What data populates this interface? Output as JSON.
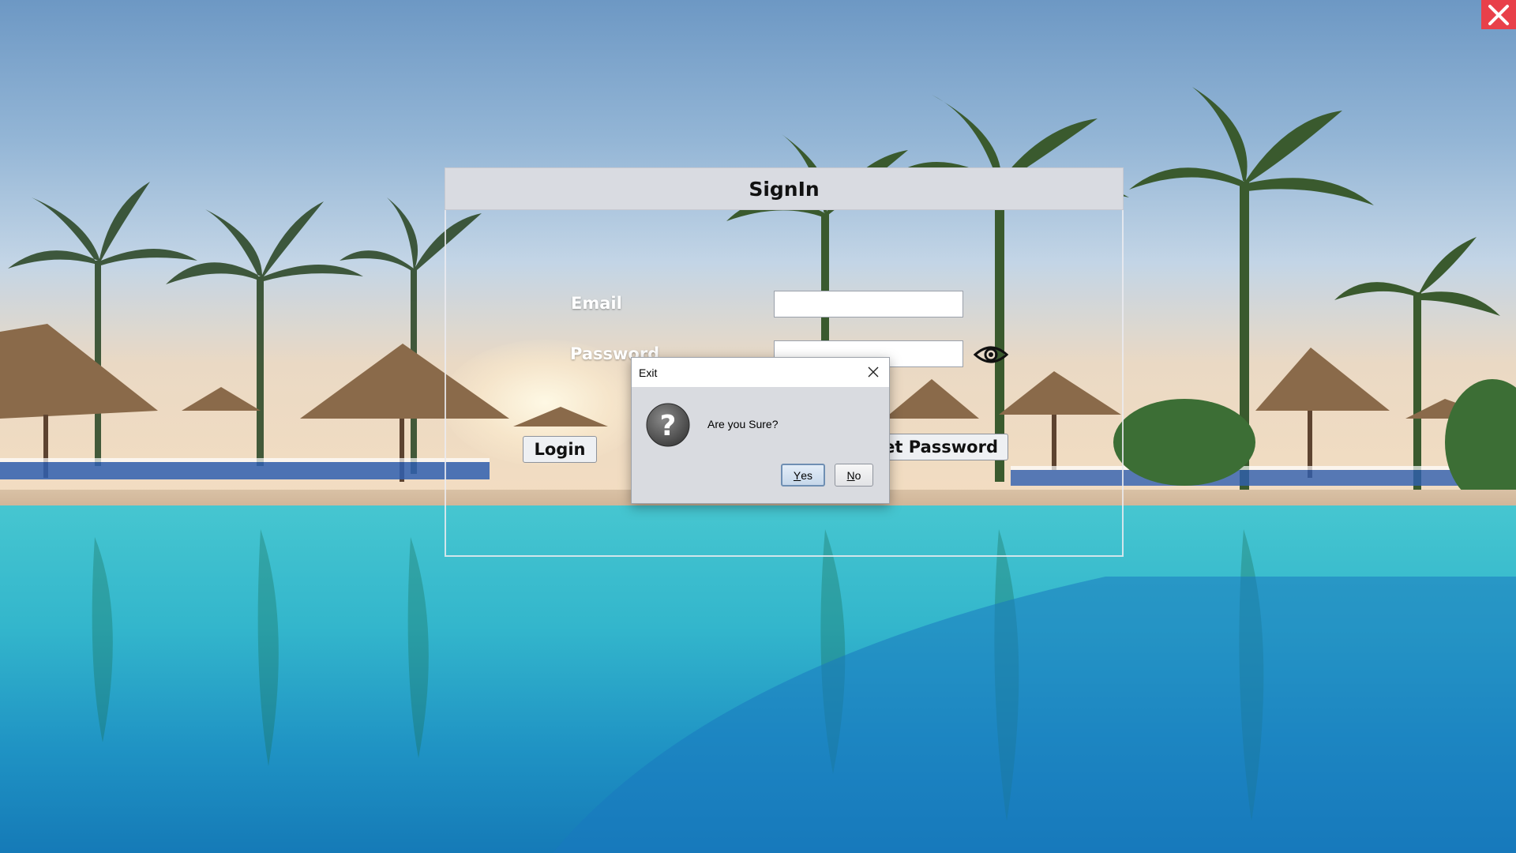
{
  "window": {
    "close_icon": "close-x-icon",
    "close_color": "#e8404a"
  },
  "background": {
    "scene": "resort-pool-palm-trees"
  },
  "signin": {
    "title": "SignIn",
    "email_label": "Email",
    "email_value": "",
    "password_label": "Password",
    "password_value": "",
    "show_password_icon": "eye-icon",
    "login_button": "Login",
    "forget_password_button": "Forget Password"
  },
  "exit_dialog": {
    "title": "Exit",
    "close_icon": "close-icon",
    "icon": "question-icon",
    "message": "Are you Sure?",
    "yes_mnemonic": "Y",
    "yes_rest": "es",
    "no_mnemonic": "N",
    "no_rest": "o"
  },
  "colors": {
    "panel_header_bg": "#d9dbe1",
    "dialog_bg": "#d9dbe0",
    "yes_border": "#6f8fb3"
  }
}
